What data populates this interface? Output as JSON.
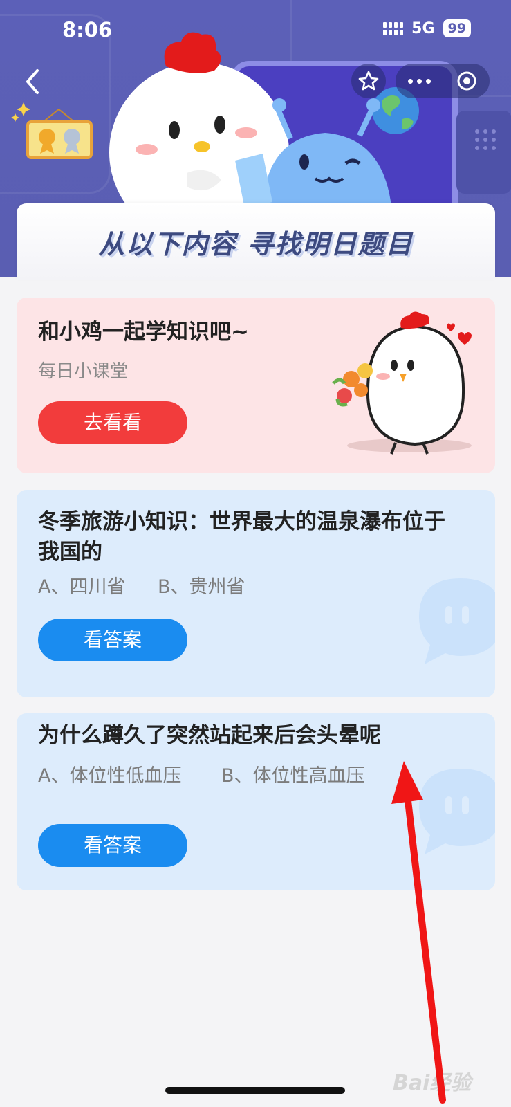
{
  "status_bar": {
    "time": "8:06",
    "network": "5G",
    "battery": "99"
  },
  "nav": {
    "back_icon": "chevron-left-icon",
    "favorite_icon": "star-icon",
    "more_icon": "more-dots-icon",
    "close_icon": "target-close-icon"
  },
  "banner": {
    "title": "从以下内容 寻找明日题目"
  },
  "lesson_card": {
    "title": "和小鸡一起学知识吧~",
    "subtitle": "每日小课堂",
    "button": "去看看"
  },
  "questions": [
    {
      "title": "冬季旅游小知识：世界最大的温泉瀑布位于我国的",
      "option_a": "A、四川省",
      "option_b": "B、贵州省",
      "button": "看答案"
    },
    {
      "title": "为什么蹲久了突然站起来后会头晕呢",
      "option_a": "A、体位性低血压",
      "option_b": "B、体位性高血压",
      "button": "看答案"
    }
  ],
  "watermark": "Bai经验",
  "colors": {
    "header": "#5a5eb2",
    "red_button": "#f23c3c",
    "blue_button": "#1a8cf0",
    "pink_card": "#fde4e6",
    "blue_card": "#ddecfc",
    "annotation_arrow": "#f01616"
  }
}
